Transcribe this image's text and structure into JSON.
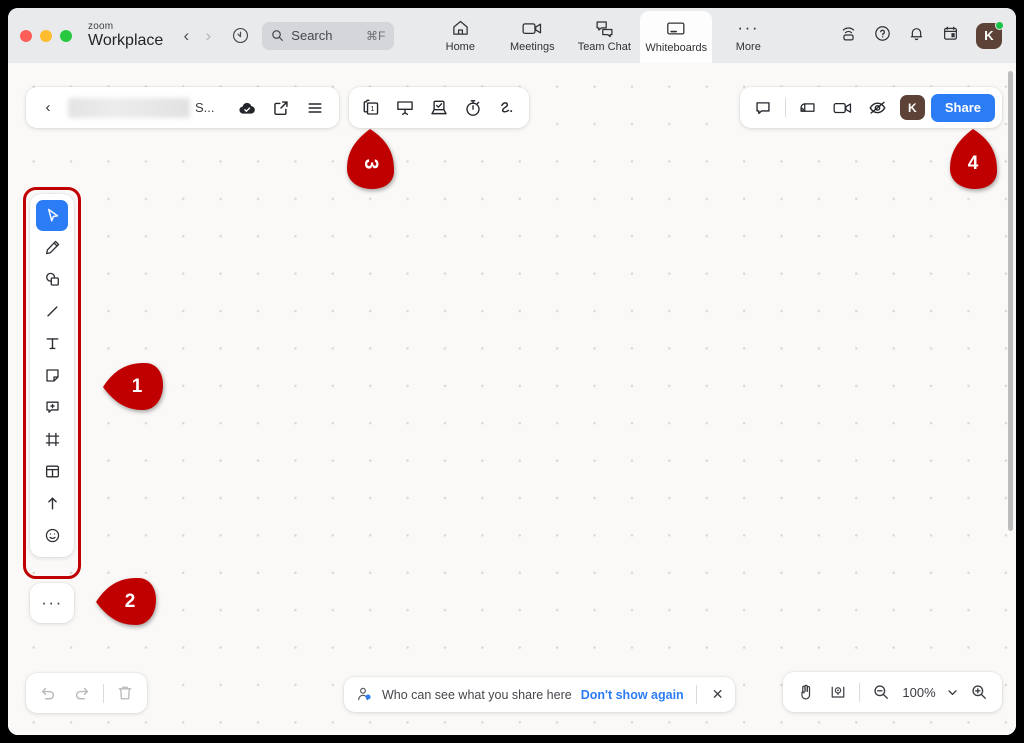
{
  "app": {
    "brand_small": "zoom",
    "brand_main": "Workplace",
    "nav_back": "‹",
    "nav_forward": "›",
    "history_icon": "history-icon"
  },
  "search": {
    "placeholder": "Search",
    "text": "Search",
    "shortcut": "⌘F",
    "icon": "search-icon"
  },
  "tabs": [
    {
      "label": "Home",
      "icon": "home-icon",
      "active": false
    },
    {
      "label": "Meetings",
      "icon": "video-icon",
      "active": false
    },
    {
      "label": "Team Chat",
      "icon": "chat-icon",
      "active": false
    },
    {
      "label": "Whiteboards",
      "icon": "whiteboard-icon",
      "active": true
    },
    {
      "label": "More",
      "icon": "ellipsis-icon",
      "active": false
    }
  ],
  "system_icons": [
    {
      "name": "cast-icon"
    },
    {
      "name": "help-icon"
    },
    {
      "name": "bell-icon"
    },
    {
      "name": "calendar-icon"
    }
  ],
  "account": {
    "initial": "K",
    "status": "online",
    "status_color": "#17c445",
    "avatar_color": "#5c4237"
  },
  "title_bar": {
    "back": "‹",
    "redacted": true,
    "title_tail": "S...",
    "buttons": [
      {
        "name": "cloud-saved-icon"
      },
      {
        "name": "share-external-icon"
      },
      {
        "name": "menu-icon"
      }
    ]
  },
  "modes_bar": {
    "buttons": [
      {
        "name": "pages-icon",
        "badge": "1"
      },
      {
        "name": "presentation-icon",
        "badge": ""
      },
      {
        "name": "vote-icon",
        "badge": ""
      },
      {
        "name": "timer-icon",
        "badge": ""
      },
      {
        "name": "laser-pointer-icon",
        "badge": ""
      }
    ]
  },
  "right_bar": {
    "buttons": [
      {
        "name": "comment-icon"
      },
      {
        "name": "screen-share-icon"
      },
      {
        "name": "video-icon"
      },
      {
        "name": "follow-me-icon"
      }
    ],
    "avatar_initial": "K",
    "share_label": "Share"
  },
  "tool_rail": {
    "tools": [
      {
        "name": "select-tool",
        "icon": "cursor-icon",
        "selected": true
      },
      {
        "name": "pen-tool",
        "icon": "pencil-icon",
        "selected": false
      },
      {
        "name": "shape-tool",
        "icon": "shapes-icon",
        "selected": false
      },
      {
        "name": "line-tool",
        "icon": "line-icon",
        "selected": false
      },
      {
        "name": "text-tool",
        "icon": "text-icon",
        "selected": false
      },
      {
        "name": "note-tool",
        "icon": "sticky-note-icon",
        "selected": false
      },
      {
        "name": "comment-tool",
        "icon": "comment-add-icon",
        "selected": false
      },
      {
        "name": "frame-tool",
        "icon": "frame-icon",
        "selected": false
      },
      {
        "name": "template-tool",
        "icon": "template-icon",
        "selected": false
      },
      {
        "name": "upload-tool",
        "icon": "upload-icon",
        "selected": false
      },
      {
        "name": "emoji-tool",
        "icon": "emoji-icon",
        "selected": false
      }
    ],
    "more_label": "···",
    "highlight_color": "#c00000",
    "selected_color": "#2c7cf6"
  },
  "bottom_bar": {
    "undo_icon": "undo-icon",
    "redo_icon": "redo-icon",
    "delete_icon": "trash-icon"
  },
  "notice": {
    "icon": "person-share-icon",
    "text": "Who can see what you share here",
    "link": "Don't show again",
    "close": "✕"
  },
  "zoom_bar": {
    "hand_icon": "hand-icon",
    "locate_icon": "locate-icon",
    "zoom_out_icon": "zoom-out-icon",
    "level": "100%",
    "chevron": "chevron-down-icon",
    "zoom_in_icon": "zoom-in-icon"
  },
  "markers": [
    {
      "label": "1",
      "direction": "left"
    },
    {
      "label": "2",
      "direction": "left"
    },
    {
      "label": "3",
      "direction": "up"
    },
    {
      "label": "4",
      "direction": "up"
    }
  ],
  "colors": {
    "marker_red": "#c00000",
    "accent_blue": "#2c7cf6",
    "canvas_bg": "#faf9f7",
    "topbar_bg": "#e9eaec"
  }
}
